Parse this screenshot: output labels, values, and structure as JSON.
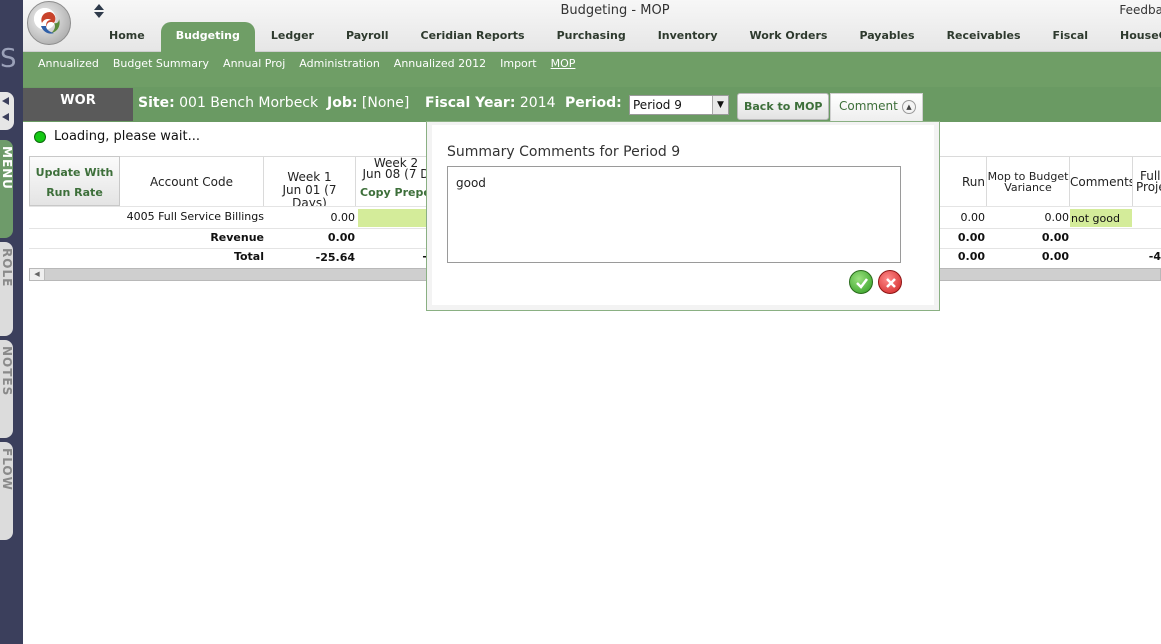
{
  "app": {
    "title": "Budgeting - MOP",
    "feedback_label": "Feedba"
  },
  "rail": {
    "letter": "S",
    "tabs": [
      "MENU",
      "ROLE",
      "NOTES",
      "FLOW"
    ]
  },
  "main_nav": {
    "items": [
      "Home",
      "Budgeting",
      "Ledger",
      "Payroll",
      "Ceridian Reports",
      "Purchasing",
      "Inventory",
      "Work Orders",
      "Payables",
      "Receivables",
      "Fiscal",
      "HouseCode"
    ],
    "active": "Budgeting"
  },
  "sub_nav": {
    "items": [
      "Annualized",
      "Budget Summary",
      "Annual Proj",
      "Administration",
      "Annualized 2012",
      "Import",
      "MOP"
    ],
    "active": "MOP"
  },
  "context": {
    "house_code": "WOR",
    "site_label": "Site:",
    "site_value": "001 Bench Morbeck",
    "job_label": "Job:",
    "job_value": "[None]",
    "fiscal_year_label": "Fiscal Year:",
    "fiscal_year_value": "2014",
    "period_label": "Period:",
    "period_selected": "Period 9",
    "back_button": "Back to MOP",
    "comment_button": "Comment"
  },
  "status": {
    "text": "Loading, please wait...",
    "color": "#14c814"
  },
  "grid": {
    "update_button_line1": "Update With",
    "update_button_line2": "Run Rate",
    "headers": {
      "account_code": "Account Code",
      "week1_title": "Week 1",
      "week1_sub": "Jun 01 (7 Days)",
      "week2_title": "Week 2",
      "week2_sub": "Jun 08 (7 D",
      "week2_link": "Copy Prepo",
      "run_rate": "Run Rate",
      "mop_variance_line1": "Mop to Budget",
      "mop_variance_line2": "Variance",
      "comments": "Comments",
      "full_proj_line1": "Full",
      "full_proj_line2": "Proje"
    },
    "rows": [
      {
        "account": "4005 Full Service Billings",
        "week1": "0.00",
        "run_rate": "0.00",
        "variance": "0.00",
        "comment": "not good",
        "full": ""
      },
      {
        "account": "Revenue",
        "week1": "0.00",
        "run_rate": "0.00",
        "variance": "0.00",
        "comment": "",
        "full": ""
      },
      {
        "account": "Total",
        "week1": "-25.64",
        "week2": "-",
        "run_rate": "0.00",
        "variance": "0.00",
        "comment": "",
        "full": "-4"
      }
    ]
  },
  "popup": {
    "title": "Summary Comments for Period 9",
    "comment_text": "good"
  }
}
